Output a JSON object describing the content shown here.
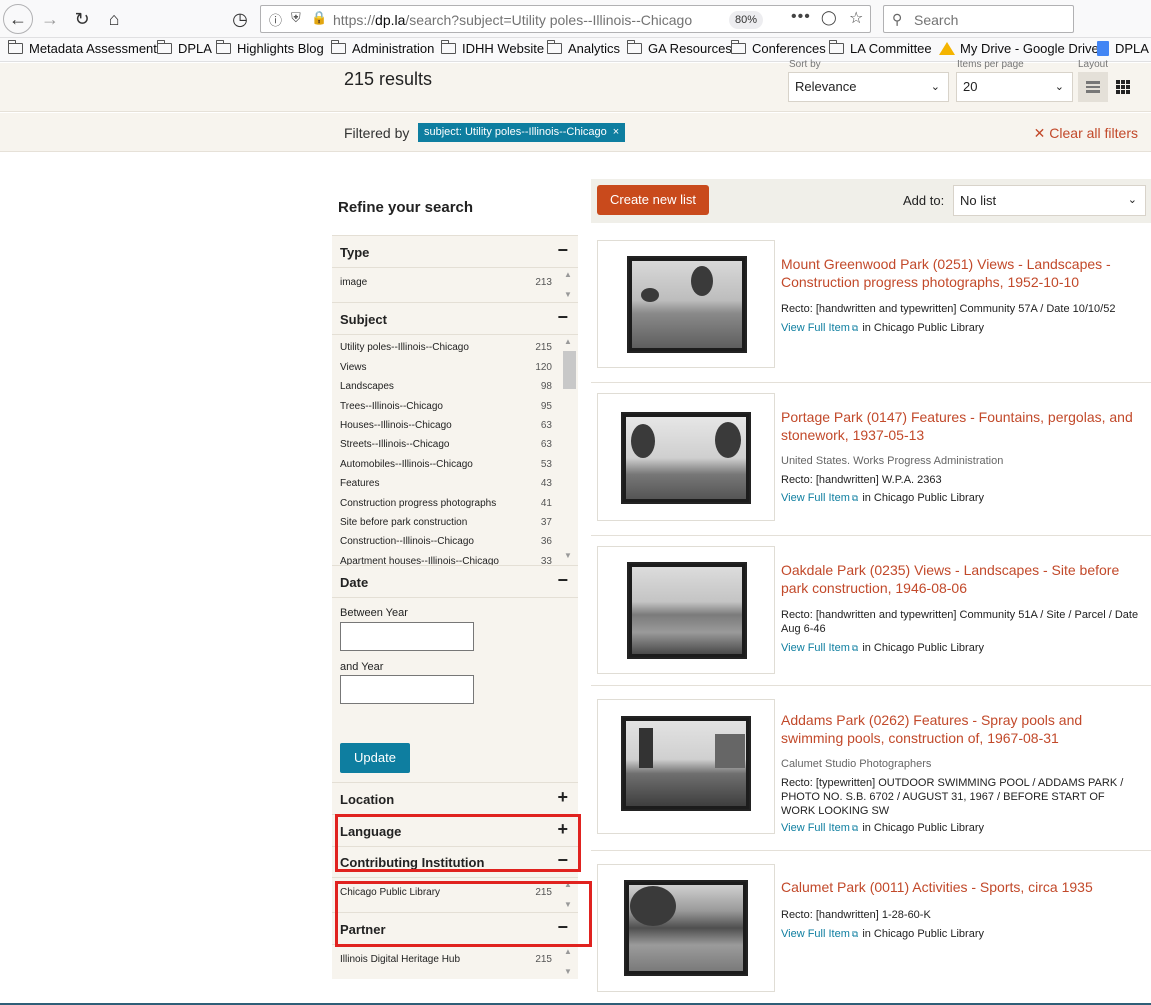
{
  "browser": {
    "url_prefix": "https://",
    "url_domain": "dp.la",
    "url_rest": "/search?subject=Utility poles--Illinois--Chicago",
    "zoom": "80%",
    "search_placeholder": "Search"
  },
  "bookmarks": [
    {
      "label": "Metadata Assessment",
      "icon": "folder-icon"
    },
    {
      "label": "DPLA",
      "icon": "folder-icon"
    },
    {
      "label": "Highlights Blog",
      "icon": "folder-icon"
    },
    {
      "label": "Administration",
      "icon": "folder-icon"
    },
    {
      "label": "IDHH Website",
      "icon": "folder-icon"
    },
    {
      "label": "Analytics",
      "icon": "folder-icon"
    },
    {
      "label": "GA Resources",
      "icon": "folder-icon"
    },
    {
      "label": "Conferences",
      "icon": "folder-icon"
    },
    {
      "label": "LA Committee",
      "icon": "folder-icon"
    },
    {
      "label": "My Drive - Google Drive",
      "icon": "google-drive-icon"
    },
    {
      "label": "DPLA",
      "icon": "google-docs-icon"
    }
  ],
  "results_header": {
    "count": "215 results",
    "sort_label": "Sort by",
    "sort_value": "Relevance",
    "per_page_label": "Items per page",
    "per_page_value": "20",
    "layout_label": "Layout"
  },
  "filters": {
    "label": "Filtered by",
    "chip": "subject: Utility poles--Illinois--Chicago",
    "chip_close": "×",
    "clear_all": "Clear all filters"
  },
  "sidebar": {
    "title": "Refine your search",
    "type": {
      "label": "Type",
      "toggle": "−",
      "items": [
        {
          "label": "image",
          "count": "213"
        }
      ]
    },
    "subject": {
      "label": "Subject",
      "toggle": "−",
      "items": [
        {
          "label": "Utility poles--Illinois--Chicago",
          "count": "215"
        },
        {
          "label": "Views",
          "count": "120"
        },
        {
          "label": "Landscapes",
          "count": "98"
        },
        {
          "label": "Trees--Illinois--Chicago",
          "count": "95"
        },
        {
          "label": "Houses--Illinois--Chicago",
          "count": "63"
        },
        {
          "label": "Streets--Illinois--Chicago",
          "count": "63"
        },
        {
          "label": "Automobiles--Illinois--Chicago",
          "count": "53"
        },
        {
          "label": "Features",
          "count": "43"
        },
        {
          "label": "Construction progress photographs",
          "count": "41"
        },
        {
          "label": "Site before park construction",
          "count": "37"
        },
        {
          "label": "Construction--Illinois--Chicago",
          "count": "36"
        },
        {
          "label": "Apartment houses--Illinois--Chicago",
          "count": "33"
        }
      ]
    },
    "date": {
      "label": "Date",
      "toggle": "−",
      "between_label": "Between Year",
      "between_value": "",
      "and_label": "and Year",
      "and_value": "",
      "update_label": "Update"
    },
    "location": {
      "label": "Location",
      "toggle": "+"
    },
    "language": {
      "label": "Language",
      "toggle": "+"
    },
    "institution": {
      "label": "Contributing Institution",
      "toggle": "−",
      "items": [
        {
          "label": "Chicago Public Library",
          "count": "215"
        }
      ]
    },
    "partner": {
      "label": "Partner",
      "toggle": "−",
      "items": [
        {
          "label": "Illinois Digital Heritage Hub",
          "count": "215"
        }
      ]
    }
  },
  "list_tools": {
    "create_label": "Create new list",
    "add_to_label": "Add to:",
    "add_to_value": "No list"
  },
  "results": [
    {
      "title": "Mount Greenwood Park (0251) Views - Landscapes - Construction progress photographs, 1952-10-10",
      "creator": "",
      "description": "Recto: [handwritten and typewritten] Community 57A / Date 10/10/52",
      "view_label": "View Full Item",
      "in_label": "in Chicago Public Library"
    },
    {
      "title": "Portage Park (0147) Features - Fountains, pergolas, and stonework, 1937-05-13",
      "creator": "United States. Works Progress Administration",
      "description": "Recto: [handwritten] W.P.A. 2363",
      "view_label": "View Full Item",
      "in_label": "in Chicago Public Library"
    },
    {
      "title": "Oakdale Park (0235) Views - Landscapes - Site before park construction, 1946-08-06",
      "creator": "",
      "description": "Recto: [handwritten and typewritten] Community 51A / Site / Parcel / Date Aug 6-46",
      "view_label": "View Full Item",
      "in_label": "in Chicago Public Library"
    },
    {
      "title": "Addams Park (0262) Features - Spray pools and swimming pools, construction of, 1967-08-31",
      "creator": "Calumet Studio Photographers",
      "description": "Recto: [typewritten] OUTDOOR SWIMMING POOL / ADDAMS PARK / PHOTO NO. S.B. 6702 / AUGUST 31, 1967 / BEFORE START OF WORK LOOKING SW",
      "view_label": "View Full Item",
      "in_label": "in Chicago Public Library"
    },
    {
      "title": "Calumet Park (0011) Activities - Sports, circa 1935",
      "creator": "",
      "description": "Recto: [handwritten] 1-28-60-K",
      "view_label": "View Full Item",
      "in_label": "in Chicago Public Library"
    }
  ],
  "colors": {
    "accent_teal": "#0e7ea0",
    "accent_orange": "#c94a1c",
    "title_link": "#c2492a",
    "annotation_red": "#e0221f"
  }
}
